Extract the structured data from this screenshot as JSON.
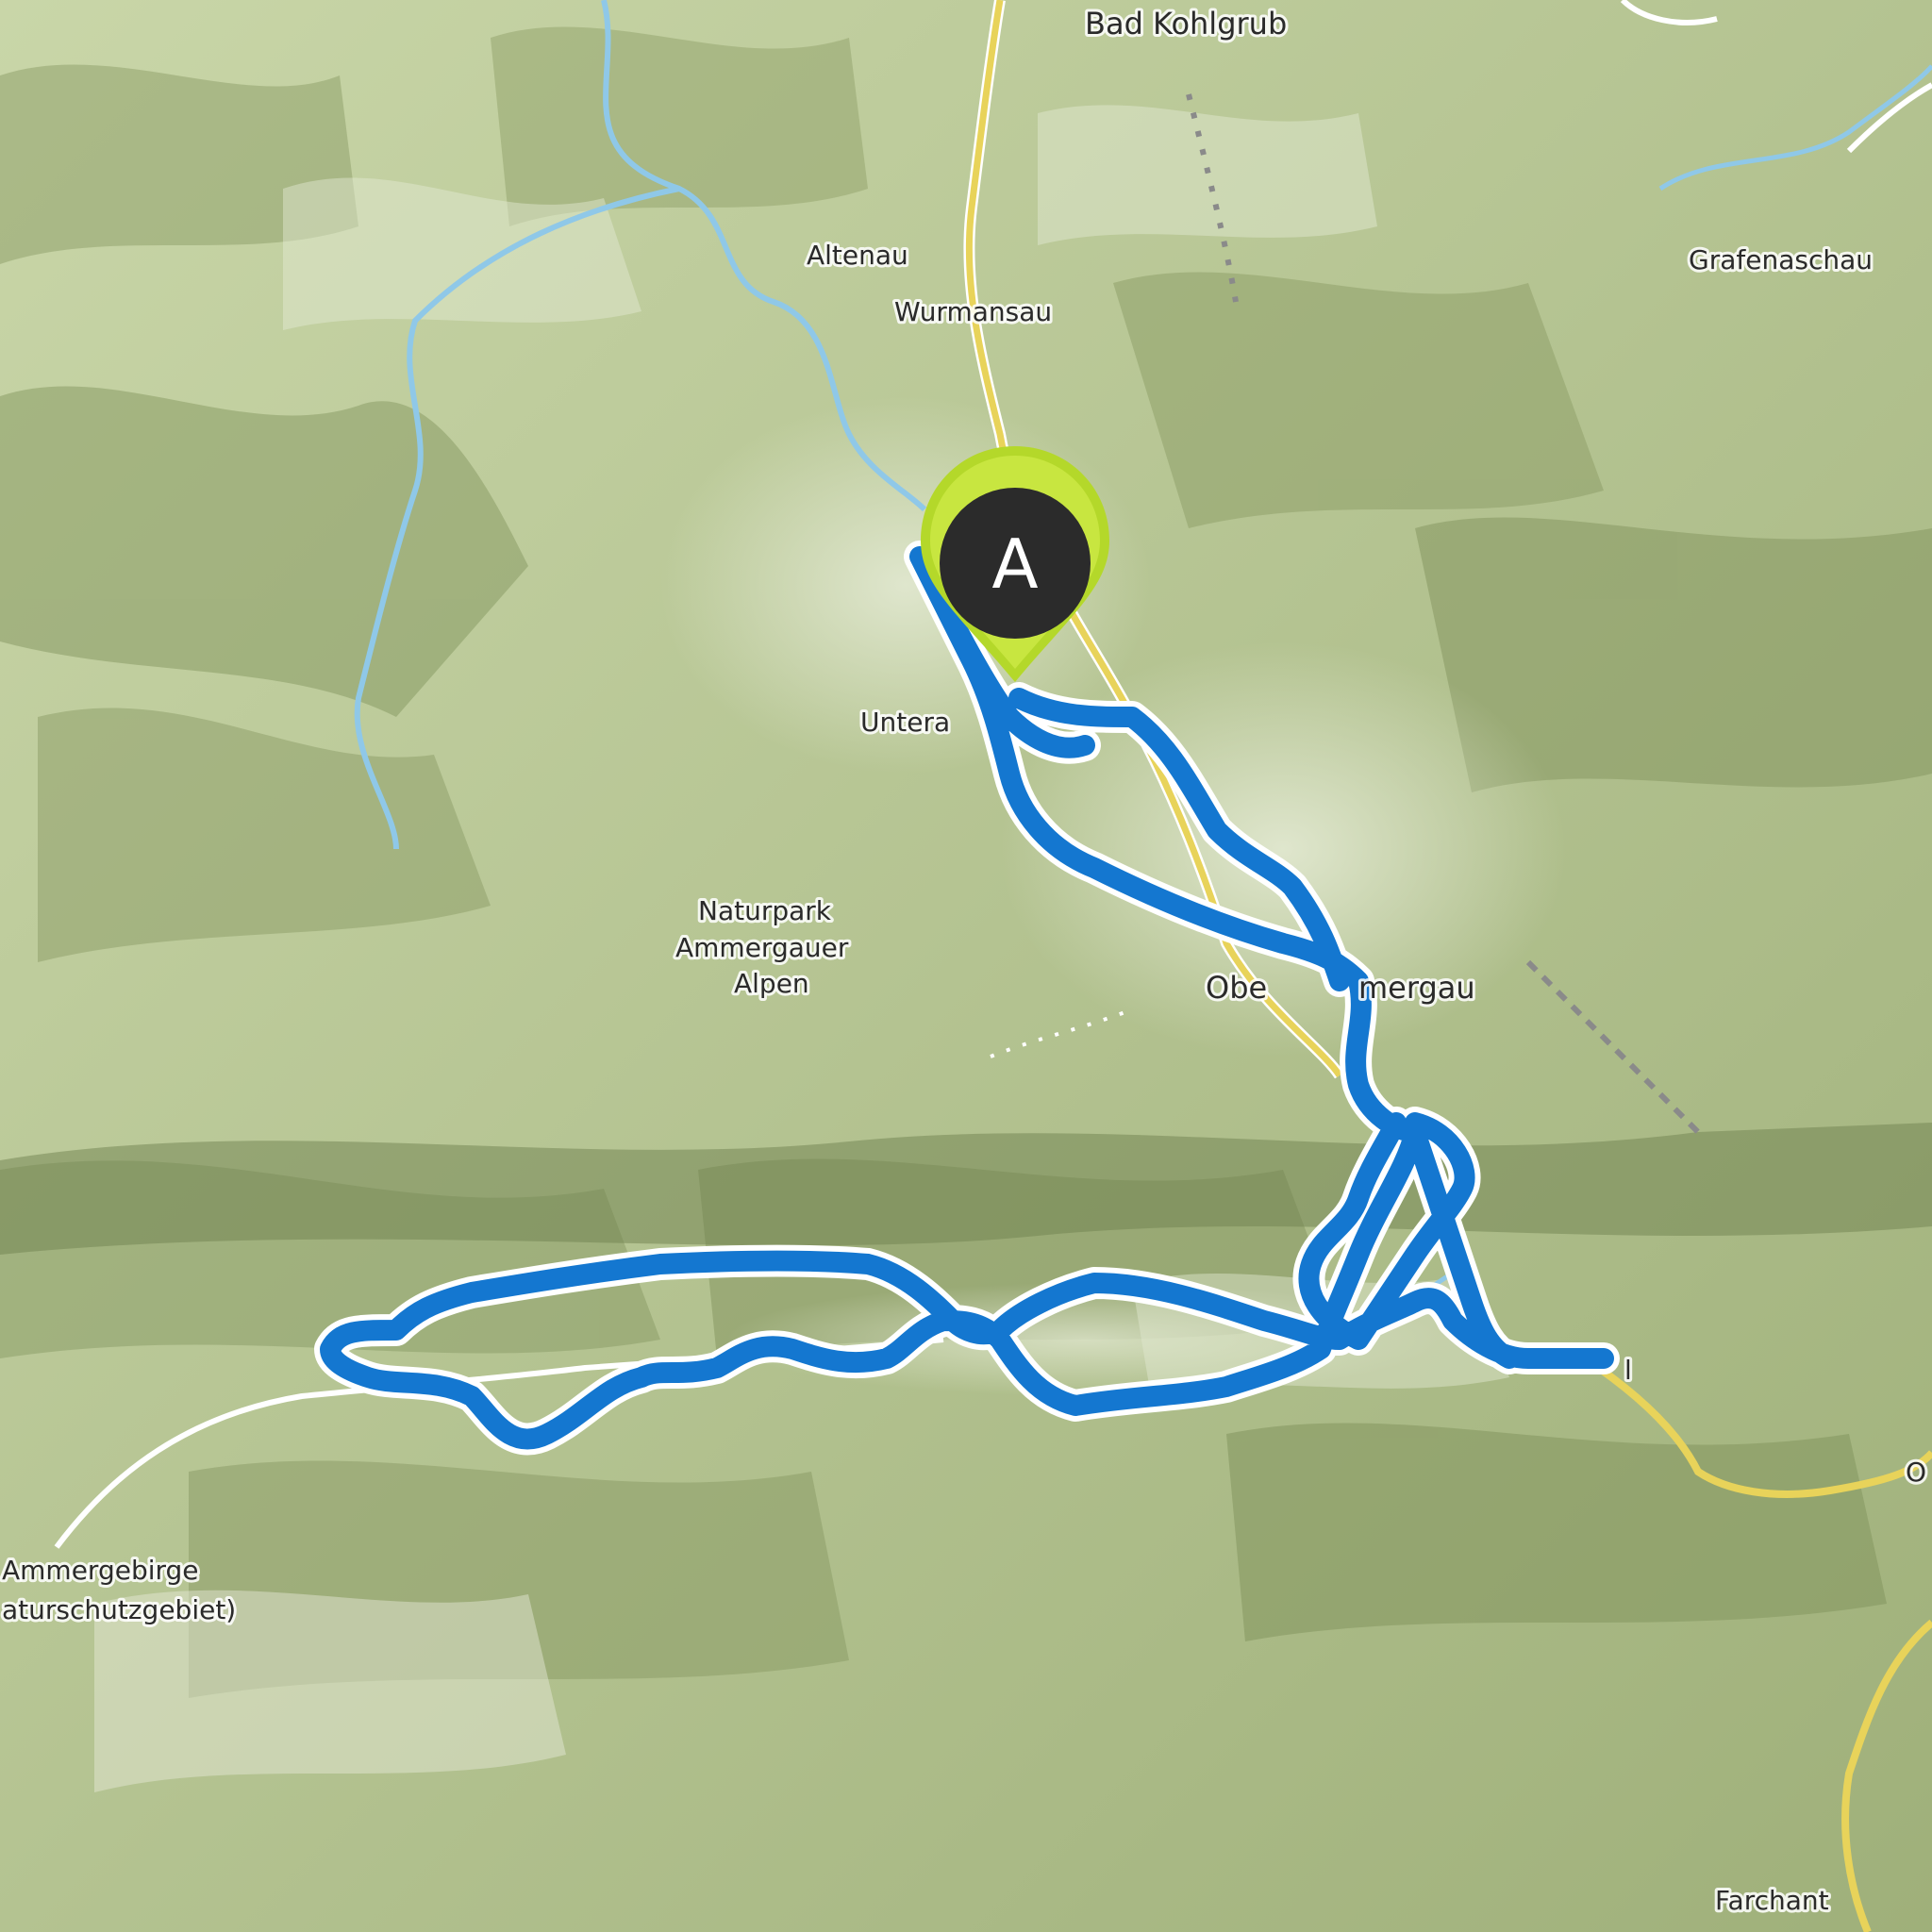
{
  "map": {
    "colors": {
      "route": "#1477d0",
      "route_outline": "#ffffff",
      "road_major": "#f1e27a",
      "road_minor": "#ffffff",
      "water": "#8fc8e8",
      "marker_fill": "#2b2b2b",
      "marker_ring": "#b4d82a"
    },
    "places": {
      "bad_kohlgrub": "Bad Kohlgrub",
      "altenau": "Altenau",
      "wurmansau": "Wurmansau",
      "grafenaschau": "Grafenaschau",
      "unterammergau": "Untera",
      "naturpark_1": "Naturpark",
      "naturpark_2": "Ammergauer",
      "naturpark_3": "Alpen",
      "oberammergau_1": "Obe",
      "oberammergau_2": "mergau",
      "ammergebirge_1": "Ammergebirge",
      "ammergebirge_2": "aturschutzgebiet)",
      "farchant": "Farchant",
      "ettal_fragment": "l",
      "oberau_fragment": "O"
    },
    "marker": {
      "label": "A",
      "icon": "start-pin-icon"
    }
  }
}
